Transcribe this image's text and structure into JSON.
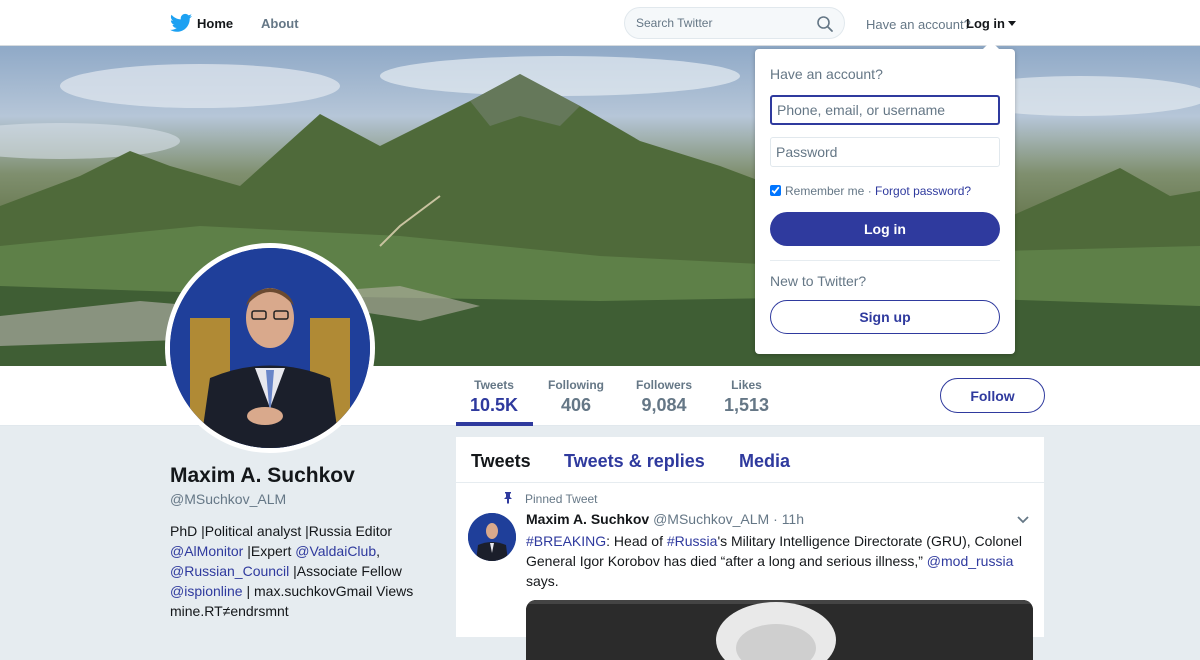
{
  "nav": {
    "brand_icon": "twitter-bird-icon",
    "home_label": "Home",
    "about_label": "About",
    "search_placeholder": "Search Twitter",
    "have_account": "Have an account?",
    "login_label": "Log in"
  },
  "login_dropdown": {
    "title": "Have an account?",
    "username_placeholder": "Phone, email, or username",
    "password_placeholder": "Password",
    "remember_label": "Remember me",
    "separator": "·",
    "forgot_label": "Forgot password?",
    "login_button": "Log in",
    "new_label": "New to Twitter?",
    "signup_button": "Sign up"
  },
  "stats": [
    {
      "label": "Tweets",
      "value": "10.5K"
    },
    {
      "label": "Following",
      "value": "406"
    },
    {
      "label": "Followers",
      "value": "9,084"
    },
    {
      "label": "Likes",
      "value": "1,513"
    }
  ],
  "follow_label": "Follow",
  "profile": {
    "name": "Maxim A. Suchkov",
    "handle": "@MSuchkov_ALM",
    "bio": {
      "p1": "PhD |Political analyst |Russia Editor ",
      "m1": "@AlMonitor",
      "p2": " |Expert ",
      "m2": "@ValdaiClub",
      "p3": ", ",
      "m3": "@Russian_Council",
      "p4": " |Associate Fellow ",
      "m4": "@ispionline",
      "p5": " | max.suchkovGmail Views mine.RT≠endrsmnt"
    }
  },
  "timeline": {
    "tabs": [
      "Tweets",
      "Tweets & replies",
      "Media"
    ],
    "pinned_label": "Pinned Tweet",
    "tweet": {
      "name": "Maxim A. Suchkov",
      "handle": "@MSuchkov_ALM",
      "dot": " · ",
      "time": "11h",
      "h1": "#BREAKING",
      "t1": ": Head of ",
      "h2": "#Russia",
      "t2": "'s Military Intelligence Directorate (GRU), Colonel General Igor Korobov has died “after a long and serious illness,” ",
      "m1": "@mod_russia",
      "t3": " says."
    }
  },
  "colors": {
    "accent": "#2f3a9e",
    "twitter_blue": "#1da1f2",
    "muted": "#657786",
    "background": "#e6ecf0"
  }
}
